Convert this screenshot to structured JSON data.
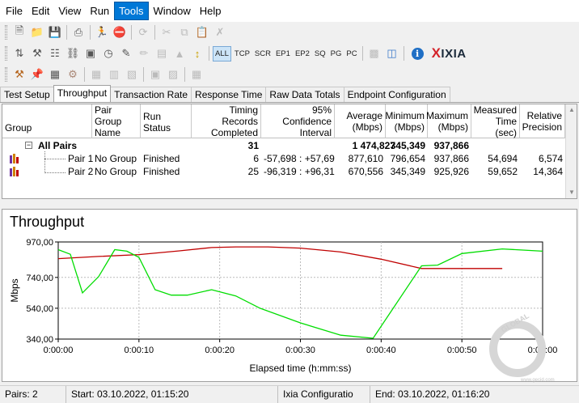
{
  "menu": [
    "File",
    "Edit",
    "View",
    "Run",
    "Tools",
    "Window",
    "Help"
  ],
  "menu_active_index": 4,
  "toolbar_filters": [
    "ALL",
    "TCP",
    "SCR",
    "EP1",
    "EP2",
    "SQ",
    "PG",
    "PC"
  ],
  "toolbar_filter_selected": "ALL",
  "brand": {
    "x": "X",
    "name": "IXIA"
  },
  "tabs": [
    "Test Setup",
    "Throughput",
    "Transaction Rate",
    "Response Time",
    "Raw Data Totals",
    "Endpoint Configuration"
  ],
  "active_tab": "Throughput",
  "grid": {
    "headers": {
      "group": "Group",
      "pair_group_name": "Pair Group Name",
      "run_status": "Run Status",
      "timing_records": "Timing Records Completed",
      "confidence": "95% Confidence Interval",
      "average": "Average (Mbps)",
      "minimum": "Minimum (Mbps)",
      "maximum": "Maximum (Mbps)",
      "measured_time": "Measured Time (sec)",
      "relative_precision": "Relative Precision"
    },
    "summary": {
      "group": "All Pairs",
      "timing_records": "31",
      "average": "1 474,827",
      "minimum": "345,349",
      "maximum": "937,866"
    },
    "rows": [
      {
        "group": "Pair 1",
        "pair_group_name": "No Group",
        "run_status": "Finished",
        "timing_records": "6",
        "confidence": "-57,698 : +57,698",
        "average": "877,610",
        "minimum": "796,654",
        "maximum": "937,866",
        "measured_time": "54,694",
        "relative_precision": "6,574"
      },
      {
        "group": "Pair 2",
        "pair_group_name": "No Group",
        "run_status": "Finished",
        "timing_records": "25",
        "confidence": "-96,319 : +96,319",
        "average": "670,556",
        "minimum": "345,349",
        "maximum": "925,926",
        "measured_time": "59,652",
        "relative_precision": "14,364"
      }
    ]
  },
  "chart_data": {
    "type": "line",
    "title": "Throughput",
    "xlabel": "Elapsed time (h:mm:ss)",
    "ylabel": "Mbps",
    "x_tick_labels": [
      "0:00:00",
      "0:00:10",
      "0:00:20",
      "0:00:30",
      "0:00:40",
      "0:00:50",
      "0:01:00"
    ],
    "y_tick_labels": [
      "340,00",
      "540,00",
      "740,00",
      "970,00"
    ],
    "xlim": [
      0,
      60
    ],
    "ylim": [
      340,
      970
    ],
    "grid": true,
    "series": [
      {
        "color": "#c00000",
        "x": [
          0,
          5,
          10,
          15,
          19,
          22,
          26,
          30,
          35,
          40,
          45,
          50,
          55
        ],
        "y": [
          862,
          876,
          888,
          912,
          934,
          938,
          938,
          930,
          905,
          858,
          798,
          798,
          798
        ]
      },
      {
        "color": "#00dd00",
        "x": [
          0,
          1.5,
          3,
          5,
          7,
          8.5,
          10,
          12,
          14,
          16,
          19,
          22,
          25,
          30,
          35,
          39,
          45,
          47,
          50,
          55,
          60
        ],
        "y": [
          920,
          890,
          640,
          745,
          920,
          910,
          870,
          660,
          625,
          625,
          660,
          620,
          540,
          445,
          365,
          345,
          815,
          820,
          895,
          925,
          910
        ]
      }
    ]
  },
  "watermark": {
    "line1": "GLOBAL",
    "line2": "www.gecid.com"
  },
  "status": {
    "pairs": "Pairs: 2",
    "start": "Start: 03.10.2022, 01:15:20",
    "config": "Ixia Configuratio",
    "end": "End: 03.10.2022, 01:16:20"
  }
}
